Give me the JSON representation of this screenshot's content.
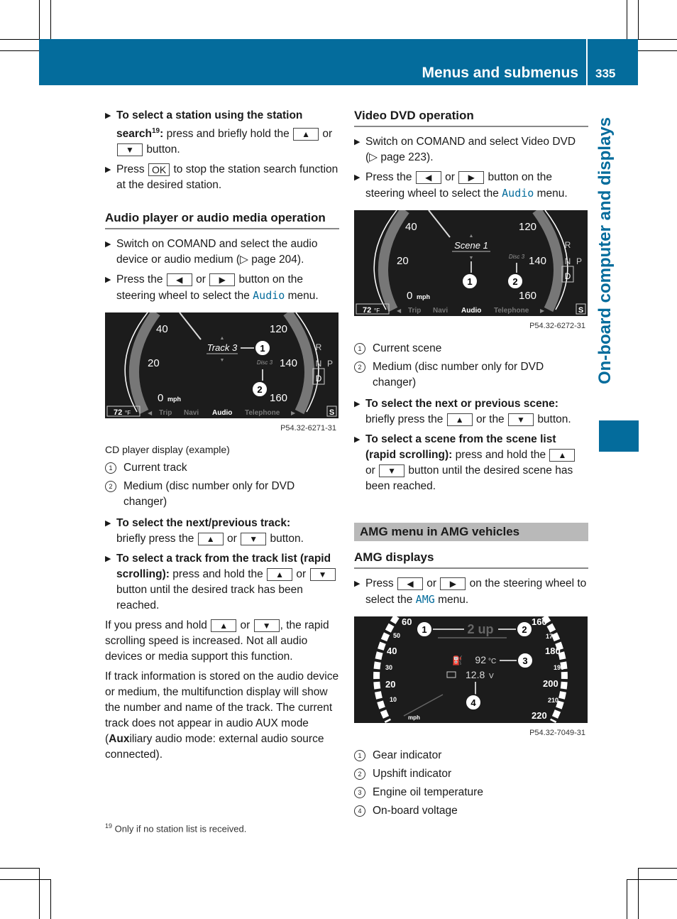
{
  "header": {
    "title": "Menus and submenus",
    "page_number": "335"
  },
  "side_tab": {
    "label": "On-board computer and displays"
  },
  "colors": {
    "brand_blue": "#046c9c",
    "section_band": "#b9b9b9"
  },
  "left": {
    "station_search": {
      "bold": "To select a station using the station search",
      "footnote_ref": "19",
      "text_before": ": press and briefly hold the",
      "key_up": "▲",
      "or": "or",
      "key_down": "▼",
      "text_after": "button."
    },
    "press_ok": {
      "pre": "Press",
      "key_ok": "OK",
      "post": "to stop the station search function at the desired station."
    },
    "audio_heading": "Audio player or audio media operation",
    "audio_b1": "Switch on COMAND and select the audio device or audio medium (▷ page 204).",
    "audio_b2": {
      "pre": "Press the",
      "key_left": "◀",
      "or": "or",
      "key_right": "▶",
      "mid": "button on the steering wheel to select the",
      "menu": "Audio",
      "post": "menu."
    },
    "figure": {
      "speeds_left": [
        "40",
        "20",
        "0"
      ],
      "unit": "mph",
      "speeds_right": [
        "120",
        "140",
        "160"
      ],
      "track": "Track 3",
      "disc": "Disc 3",
      "gears": [
        "R",
        "N",
        "D",
        "P"
      ],
      "temp": "72",
      "temp_unit": "°F",
      "menu": [
        "Trip",
        "Navi",
        "Audio",
        "Telephone"
      ],
      "s_badge": "S",
      "callouts": [
        "1",
        "2"
      ],
      "id": "P54.32-6271-31"
    },
    "caption": "CD player display (example)",
    "legend": [
      {
        "num": "1",
        "text": "Current track"
      },
      {
        "num": "2",
        "text": "Medium (disc number only for DVD changer)"
      }
    ],
    "next_track": {
      "bold": "To select the next/previous track:",
      "pre": "briefly press the",
      "key_up": "▲",
      "or": "or",
      "key_down": "▼",
      "post": "button."
    },
    "track_list": {
      "bold": "To select a track from the track list (rapid scrolling):",
      "pre": "press and hold the",
      "key_up": "▲",
      "or": "or",
      "key_down": "▼",
      "post": "button until the desired track has been reached."
    },
    "para1": {
      "pre": "If you press and hold",
      "key_up": "▲",
      "or": "or",
      "key_down": "▼",
      "post": ", the rapid scrolling speed is increased. Not all audio devices or media support this function."
    },
    "para2": "If track information is stored on the audio device or medium, the multifunction display will show the number and name of the track. The current track does not appear in audio AUX mode (",
    "para2_bold": "Aux",
    "para2_end": "iliary audio mode: external audio source connected)."
  },
  "right": {
    "dvd_heading": "Video DVD operation",
    "dvd_b1": "Switch on COMAND and select Video DVD (▷ page 223).",
    "dvd_b2": {
      "pre": "Press the",
      "key_left": "◀",
      "or": "or",
      "key_right": "▶",
      "mid": "button on the steering wheel to select the",
      "menu": "Audio",
      "post": "menu."
    },
    "figure": {
      "speeds_left": [
        "40",
        "20",
        "0"
      ],
      "unit": "mph",
      "speeds_right": [
        "120",
        "140",
        "160"
      ],
      "scene": "Scene 1",
      "disc": "Disc 3",
      "gears": [
        "R",
        "N",
        "D",
        "P"
      ],
      "temp": "72",
      "temp_unit": "°F",
      "menu": [
        "Trip",
        "Navi",
        "Audio",
        "Telephone"
      ],
      "s_badge": "S",
      "callouts": [
        "1",
        "2"
      ],
      "id": "P54.32-6272-31"
    },
    "legend": [
      {
        "num": "1",
        "text": "Current scene"
      },
      {
        "num": "2",
        "text": "Medium (disc number only for DVD changer)"
      }
    ],
    "next_scene": {
      "bold": "To select the next or previous scene:",
      "pre": "briefly press the",
      "key_up": "▲",
      "or": "or the",
      "key_down": "▼",
      "post": "button."
    },
    "scene_list": {
      "bold": "To select a scene from the scene list (rapid scrolling):",
      "pre": "press and hold the",
      "key_up": "▲",
      "or": "or",
      "key_down": "▼",
      "post": "button until the desired scene has been reached."
    },
    "amg_band": "AMG menu in AMG vehicles",
    "amg_heading": "AMG displays",
    "amg_b1": {
      "pre": "Press",
      "key_left": "◀",
      "or": "or",
      "key_right": "▶",
      "mid": "on the steering wheel to select the",
      "menu": "AMG",
      "post": "menu."
    },
    "amg_figure": {
      "speeds_left": [
        "60",
        "50",
        "40",
        "30",
        "20",
        "10"
      ],
      "unit": "mph",
      "speeds_right": [
        "160",
        "170",
        "180",
        "190",
        "200",
        "210",
        "220"
      ],
      "gear": "2 up",
      "oil_temp": "92",
      "oil_unit": "°C",
      "voltage": "12.8",
      "voltage_unit": "V",
      "callouts": [
        "1",
        "2",
        "3",
        "4"
      ],
      "id": "P54.32-7049-31"
    },
    "amg_legend": [
      {
        "num": "1",
        "text": "Gear indicator"
      },
      {
        "num": "2",
        "text": "Upshift indicator"
      },
      {
        "num": "3",
        "text": "Engine oil temperature"
      },
      {
        "num": "4",
        "text": "On-board voltage"
      }
    ]
  },
  "footnote": {
    "num": "19",
    "text": "Only if no station list is received."
  }
}
